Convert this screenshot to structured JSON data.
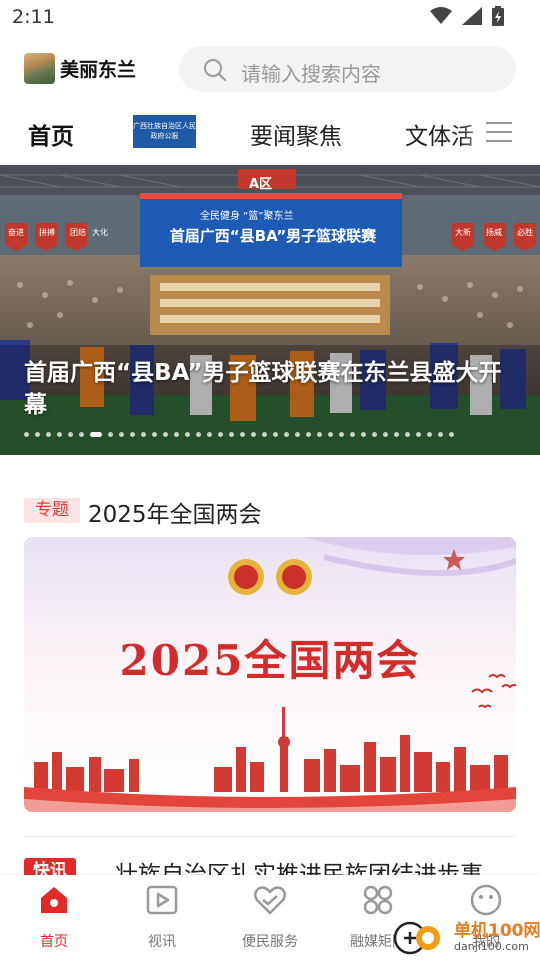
{
  "status_bar": {
    "time": "2:11"
  },
  "header": {
    "app_title": "美丽东兰",
    "search_placeholder": "请输入搜索内容"
  },
  "tabs": [
    {
      "label": "首页"
    },
    {
      "label": "广西壮族自治区人民政府公报",
      "image": true
    },
    {
      "label": "要闻聚焦"
    },
    {
      "label": "文体活"
    }
  ],
  "banner": {
    "caption": "首届广西“县BA”男子篮球联赛在东兰县盛大开幕",
    "sign_area": "A区",
    "sign_slogan": "全民健身 “篮”聚东兰",
    "sign_title": "首届广西“县BA”男子篮球联赛",
    "flags_left": [
      "奋进",
      "拼搏",
      "团结",
      "大化"
    ],
    "flags_right": [
      "大新",
      "扬威",
      "必胜"
    ],
    "dot_count": 39,
    "active_dot": 6
  },
  "topic": {
    "tag": "专题",
    "title": "2025年全国两会",
    "image_text": "2025全国两会"
  },
  "next_item": {
    "tag": "快讯",
    "title": "…壮族自治区扎实推进民族团结进步事"
  },
  "bottom_nav": [
    {
      "label": "首页",
      "icon": "home-icon",
      "active": true
    },
    {
      "label": "视讯",
      "icon": "video-icon"
    },
    {
      "label": "便民服务",
      "icon": "heart-hand-icon"
    },
    {
      "label": "融媒矩阵",
      "icon": "grid-icon"
    },
    {
      "label": "我的",
      "icon": "profile-icon"
    }
  ],
  "watermark": {
    "brand": "单机100网",
    "url": "danji100.com"
  },
  "colors": {
    "accent": "#e32a2a",
    "tag_bg": "#fde3e3",
    "search_bg": "#f2f3f5"
  }
}
